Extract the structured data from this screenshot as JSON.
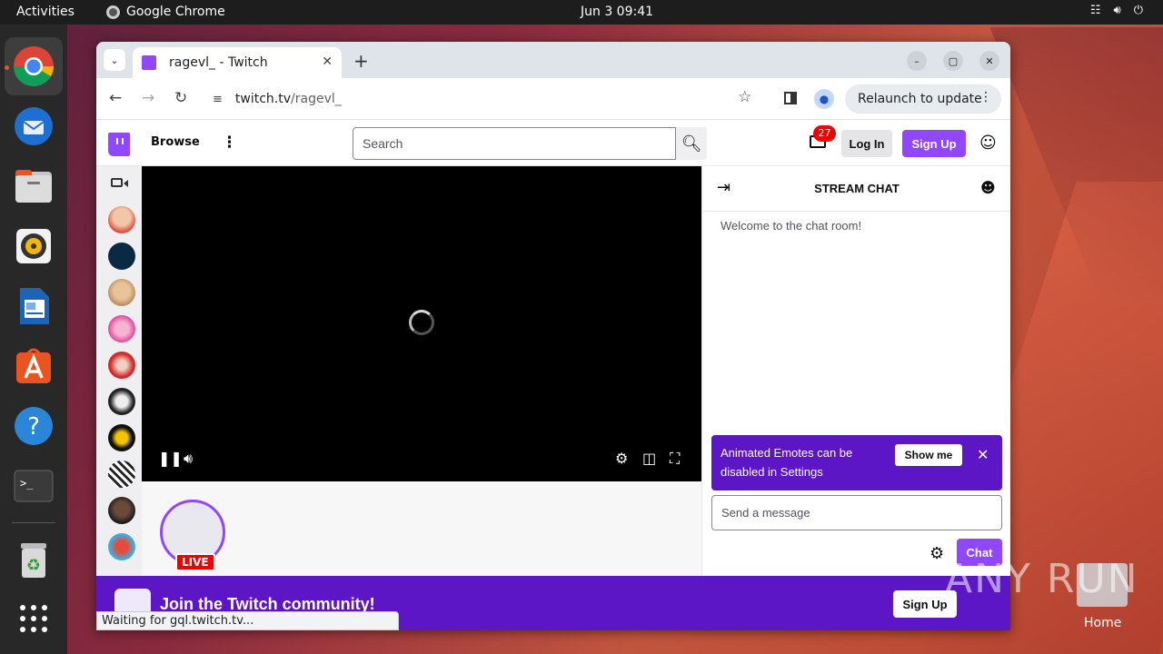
{
  "topbar": {
    "activities": "Activities",
    "app_name": "Google Chrome",
    "clock": "Jun 3  09:41"
  },
  "dock": {
    "items": [
      "chrome-icon",
      "thunderbird-icon",
      "files-icon",
      "rhythmbox-icon",
      "writer-icon",
      "app-center-icon",
      "help-icon",
      "terminal-icon",
      "trash-icon",
      "apps-grid-icon"
    ]
  },
  "browser": {
    "tab_title": "ragevl_ - Twitch",
    "url_host": "twitch.tv",
    "url_path": "/ragevl_",
    "relaunch": "Relaunch to update",
    "status": "Waiting for gql.twitch.tv..."
  },
  "twitch": {
    "browse": "Browse",
    "search_placeholder": "Search",
    "notification_count": "27",
    "login": "Log In",
    "signup": "Sign Up",
    "live_label": "LIVE",
    "chat": {
      "title": "STREAM CHAT",
      "welcome": "Welcome to the chat room!",
      "emote_notice": "Animated Emotes can be disabled in Settings",
      "show_me": "Show me",
      "message_placeholder": "Send a message",
      "send": "Chat"
    },
    "join_text": "Join the Twitch community!",
    "join_signup": "Sign Up"
  },
  "desktop": {
    "home_label": "Home",
    "watermark": "ANY RUN"
  },
  "colors": {
    "twitch_purple": "#9146ff",
    "twitch_dark_purple": "#5c16c5",
    "live_red": "#eb0400"
  }
}
